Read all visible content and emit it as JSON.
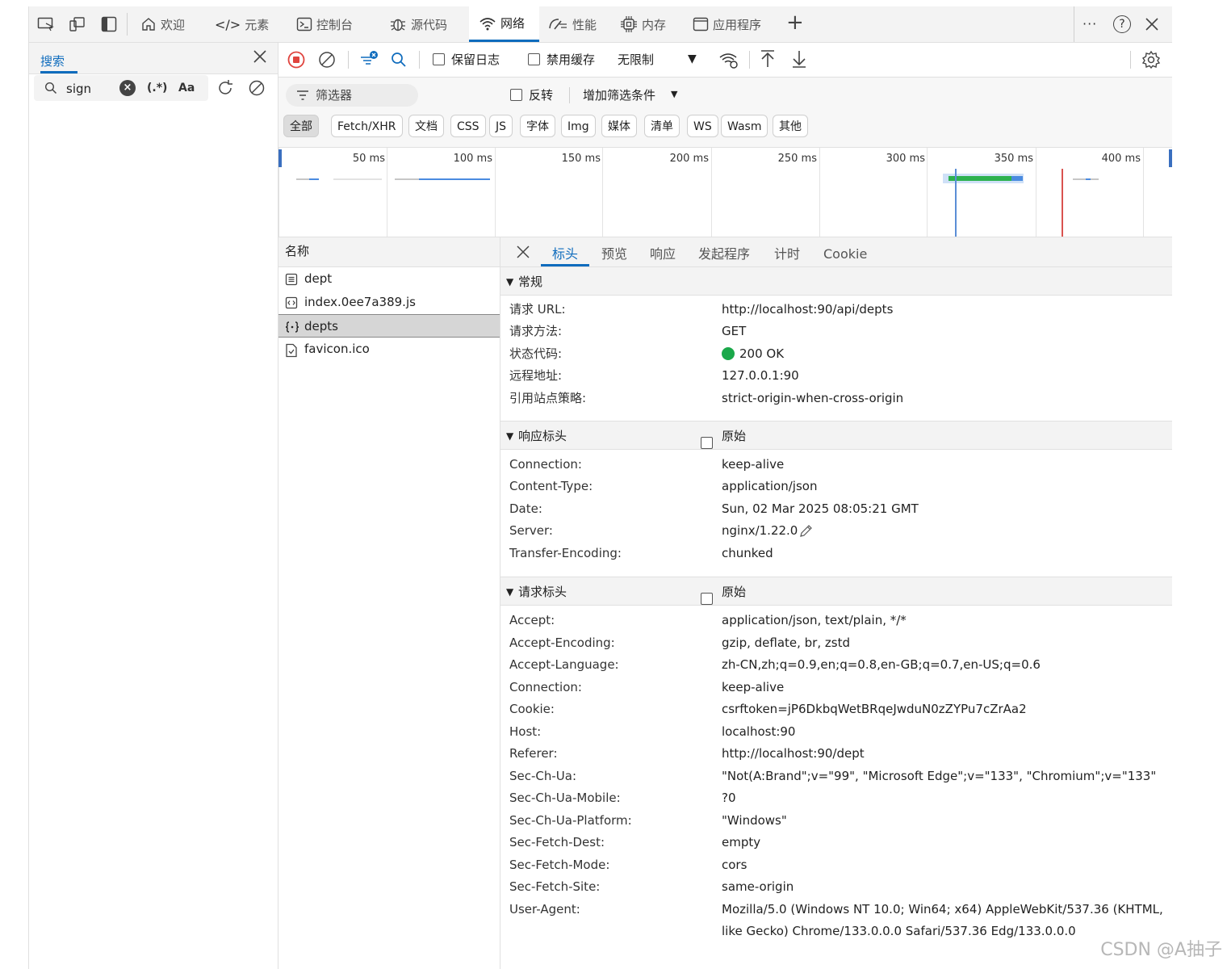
{
  "topbar": {
    "tabs": {
      "welcome": "欢迎",
      "elements": "元素",
      "console": "控制台",
      "sources": "源代码",
      "network": "网络",
      "performance": "性能",
      "memory": "内存",
      "application": "应用程序"
    },
    "more": "···",
    "help": "?"
  },
  "search": {
    "title": "搜索",
    "query": "sign",
    "regex_label": "(.*)",
    "case_label": "Aa"
  },
  "toolbar": {
    "preserve_log": "保留日志",
    "disable_cache": "禁用缓存",
    "throttle": "无限制"
  },
  "filter": {
    "placeholder": "筛选器",
    "invert": "反转",
    "more_filters": "增加筛选条件",
    "chips": [
      "全部",
      "Fetch/XHR",
      "文档",
      "CSS",
      "JS",
      "字体",
      "Img",
      "媒体",
      "清单",
      "WS",
      "Wasm",
      "其他"
    ]
  },
  "timeline": {
    "ticks": [
      "50 ms",
      "100 ms",
      "150 ms",
      "200 ms",
      "250 ms",
      "300 ms",
      "350 ms",
      "400 ms"
    ]
  },
  "requests": {
    "header": "名称",
    "items": [
      "dept",
      "index.0ee7a389.js",
      "depts",
      "favicon.ico"
    ],
    "selected_index": 2
  },
  "details": {
    "tabs": [
      "标头",
      "预览",
      "响应",
      "发起程序",
      "计时",
      "Cookie"
    ],
    "general": {
      "title": "常规",
      "rows": [
        {
          "k": "请求 URL:",
          "v": "http://localhost:90/api/depts"
        },
        {
          "k": "请求方法:",
          "v": "GET"
        },
        {
          "k": "状态代码:",
          "v": "200 OK"
        },
        {
          "k": "远程地址:",
          "v": "127.0.0.1:90"
        },
        {
          "k": "引用站点策略:",
          "v": "strict-origin-when-cross-origin"
        }
      ]
    },
    "response_headers": {
      "title": "响应标头",
      "raw": "原始",
      "rows": [
        {
          "k": "Connection:",
          "v": "keep-alive"
        },
        {
          "k": "Content-Type:",
          "v": "application/json"
        },
        {
          "k": "Date:",
          "v": "Sun, 02 Mar 2025 08:05:21 GMT"
        },
        {
          "k": "Server:",
          "v": "nginx/1.22.0"
        },
        {
          "k": "Transfer-Encoding:",
          "v": "chunked"
        }
      ]
    },
    "request_headers": {
      "title": "请求标头",
      "raw": "原始",
      "rows": [
        {
          "k": "Accept:",
          "v": "application/json, text/plain, */*"
        },
        {
          "k": "Accept-Encoding:",
          "v": "gzip, deflate, br, zstd"
        },
        {
          "k": "Accept-Language:",
          "v": "zh-CN,zh;q=0.9,en;q=0.8,en-GB;q=0.7,en-US;q=0.6"
        },
        {
          "k": "Connection:",
          "v": "keep-alive"
        },
        {
          "k": "Cookie:",
          "v": "csrftoken=jP6DkbqWetBRqeJwduN0zZYPu7cZrAa2"
        },
        {
          "k": "Host:",
          "v": "localhost:90"
        },
        {
          "k": "Referer:",
          "v": "http://localhost:90/dept"
        },
        {
          "k": "Sec-Ch-Ua:",
          "v": "\"Not(A:Brand\";v=\"99\", \"Microsoft Edge\";v=\"133\", \"Chromium\";v=\"133\""
        },
        {
          "k": "Sec-Ch-Ua-Mobile:",
          "v": "?0"
        },
        {
          "k": "Sec-Ch-Ua-Platform:",
          "v": "\"Windows\""
        },
        {
          "k": "Sec-Fetch-Dest:",
          "v": "empty"
        },
        {
          "k": "Sec-Fetch-Mode:",
          "v": "cors"
        },
        {
          "k": "Sec-Fetch-Site:",
          "v": "same-origin"
        },
        {
          "k": "User-Agent:",
          "v": "Mozilla/5.0 (Windows NT 10.0; Win64; x64) AppleWebKit/537.36 (KHTML,"
        }
      ],
      "user_agent_cont": "like Gecko) Chrome/133.0.0.0 Safari/537.36 Edg/133.0.0.0"
    }
  },
  "colors": {
    "accent": "#0f6cbd",
    "status_ok": "#1aa84a",
    "record": "#e0443e"
  },
  "watermark": "CSDN @A抽子"
}
